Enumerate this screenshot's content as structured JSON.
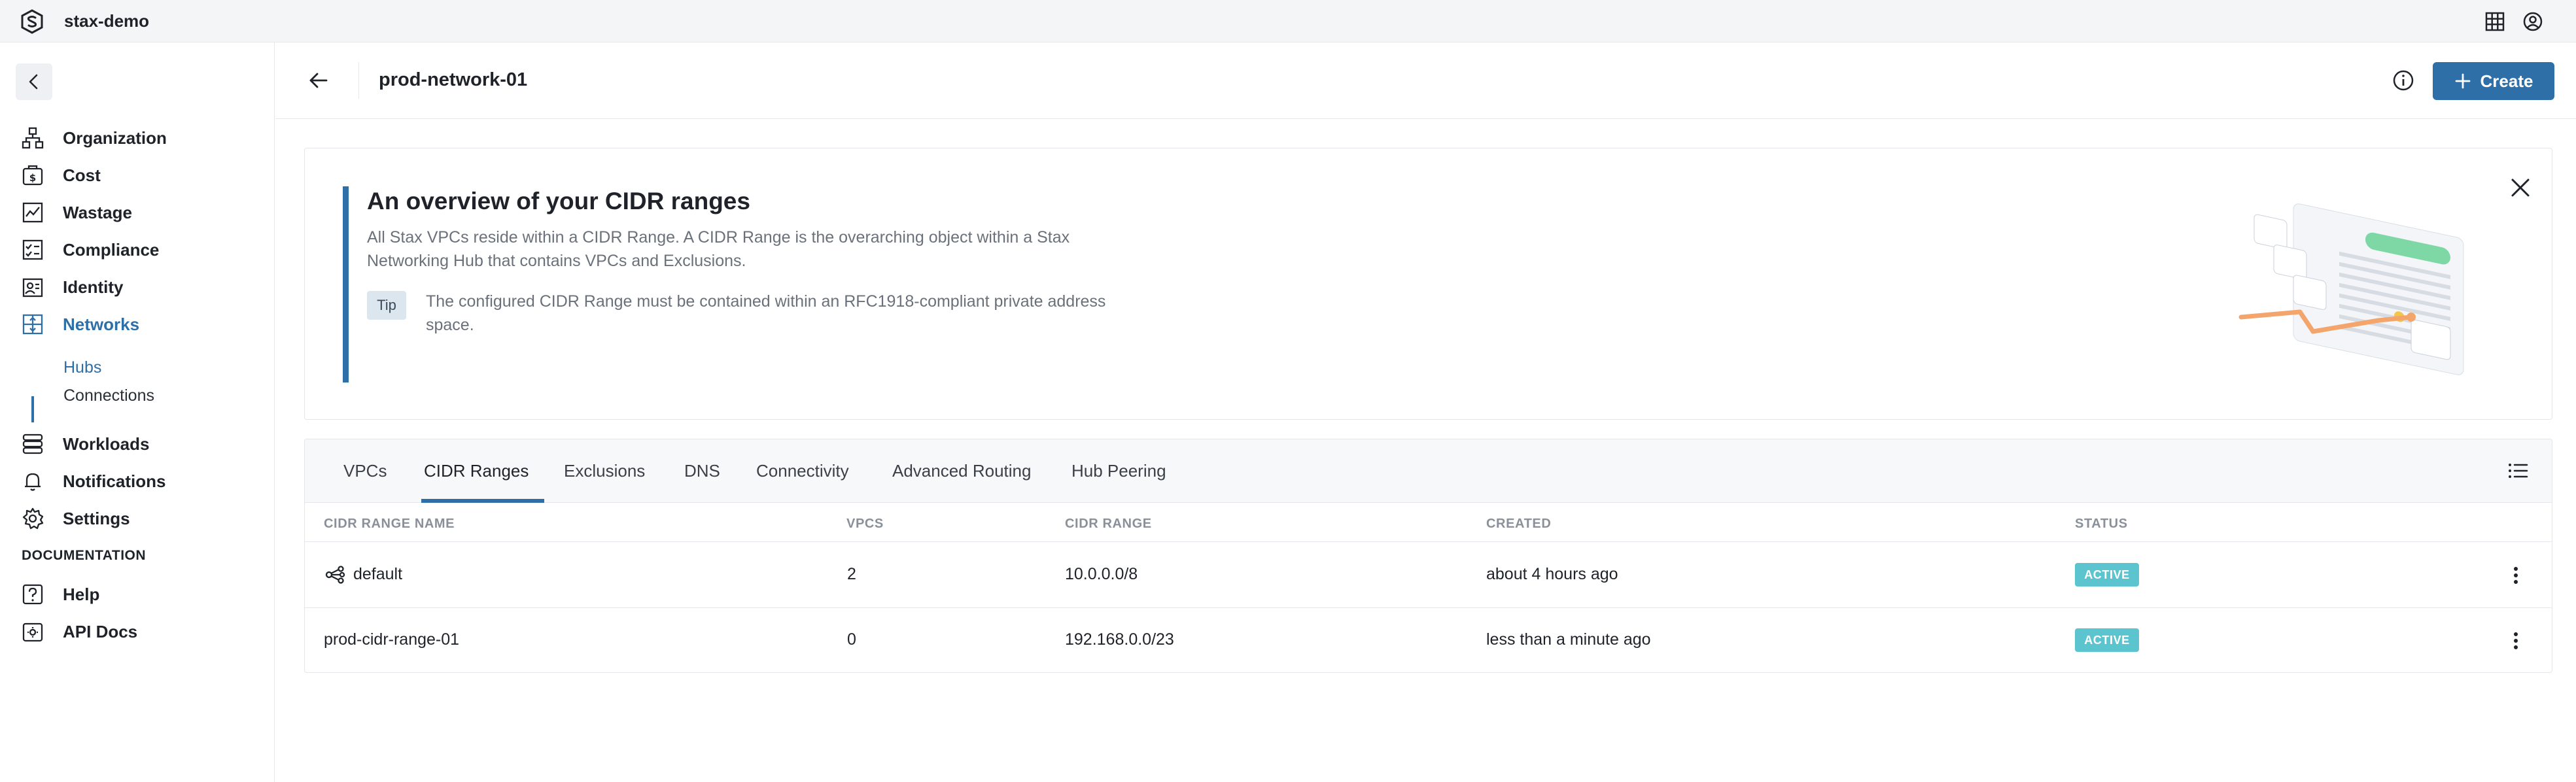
{
  "app": {
    "org_name": "stax-demo"
  },
  "sidebar": {
    "items": [
      {
        "id": "organization",
        "label": "Organization",
        "icon": "organization-icon"
      },
      {
        "id": "cost",
        "label": "Cost",
        "icon": "cost-icon"
      },
      {
        "id": "wastage",
        "label": "Wastage",
        "icon": "wastage-icon"
      },
      {
        "id": "compliance",
        "label": "Compliance",
        "icon": "compliance-icon"
      },
      {
        "id": "identity",
        "label": "Identity",
        "icon": "identity-icon"
      },
      {
        "id": "networks",
        "label": "Networks",
        "icon": "networks-icon",
        "active": true
      },
      {
        "id": "workloads",
        "label": "Workloads",
        "icon": "workloads-icon"
      },
      {
        "id": "notifications",
        "label": "Notifications",
        "icon": "bell-icon"
      },
      {
        "id": "settings",
        "label": "Settings",
        "icon": "gear-icon"
      }
    ],
    "sub_items": [
      {
        "label": "Hubs",
        "active": true
      },
      {
        "label": "Connections"
      }
    ],
    "documentation_heading": "DOCUMENTATION",
    "doc_items": [
      {
        "label": "Help",
        "icon": "help-icon"
      },
      {
        "label": "API Docs",
        "icon": "api-docs-icon"
      }
    ]
  },
  "header": {
    "title": "prod-network-01",
    "create_label": "Create"
  },
  "overview": {
    "title": "An overview of your CIDR ranges",
    "description": "All Stax VPCs reside within a CIDR Range. A CIDR Range is the overarching object within a Stax Networking Hub that contains VPCs and Exclusions.",
    "tip_label": "Tip",
    "tip_text": "The configured CIDR Range must be contained within an RFC1918-compliant private address space."
  },
  "tabs": [
    {
      "label": "VPCs"
    },
    {
      "label": "CIDR Ranges",
      "active": true
    },
    {
      "label": "Exclusions"
    },
    {
      "label": "DNS"
    },
    {
      "label": "Connectivity"
    },
    {
      "label": "Advanced Routing"
    },
    {
      "label": "Hub Peering"
    }
  ],
  "table": {
    "columns": [
      "CIDR RANGE NAME",
      "VPCS",
      "CIDR RANGE",
      "CREATED",
      "STATUS"
    ],
    "rows": [
      {
        "name": "default",
        "vpcs": "2",
        "cidr": "10.0.0.0/8",
        "created": "about 4 hours ago",
        "status": "ACTIVE",
        "has_icon": true
      },
      {
        "name": "prod-cidr-range-01",
        "vpcs": "0",
        "cidr": "192.168.0.0/23",
        "created": "less than a minute ago",
        "status": "ACTIVE",
        "has_icon": false
      }
    ]
  },
  "colors": {
    "accent": "#2f6fa8",
    "status_active": "#5bc4cf"
  }
}
